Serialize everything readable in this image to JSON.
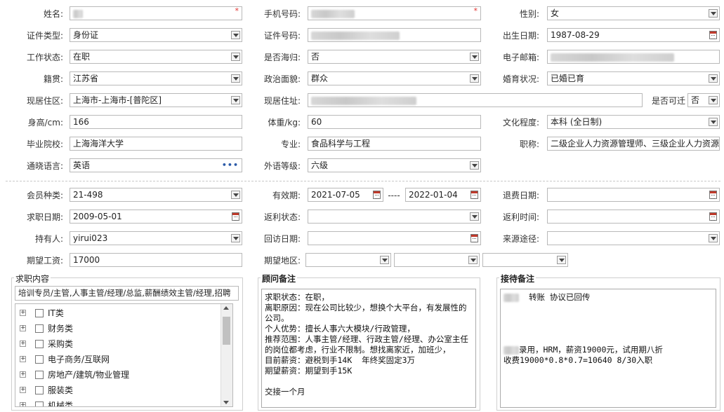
{
  "fields": {
    "name": {
      "label": "姓名:"
    },
    "phone": {
      "label": "手机号码:"
    },
    "gender": {
      "label": "性别:",
      "value": "女"
    },
    "id_type": {
      "label": "证件类型:",
      "value": "身份证"
    },
    "id_number": {
      "label": "证件号码:"
    },
    "birthdate": {
      "label": "出生日期:",
      "value": "1987-08-29"
    },
    "work_status": {
      "label": "工作状态:",
      "value": "在职"
    },
    "returnee": {
      "label": "是否海归:",
      "value": "否"
    },
    "email": {
      "label": "电子邮箱:"
    },
    "native_place": {
      "label": "籍贯:",
      "value": "江苏省"
    },
    "political_status": {
      "label": "政治面貌:",
      "value": "群众"
    },
    "marital_status": {
      "label": "婚育状况:",
      "value": "已婚已育"
    },
    "current_area": {
      "label": "现居住区:",
      "value": "上海市-上海市-[普陀区]"
    },
    "current_address": {
      "label": "现居住址:"
    },
    "relocate": {
      "label": "是否可迁",
      "value": "否"
    },
    "height": {
      "label": "身高/cm:",
      "value": "166"
    },
    "weight": {
      "label": "体重/kg:",
      "value": "60"
    },
    "education": {
      "label": "文化程度:",
      "value": "本科 (全日制)"
    },
    "school": {
      "label": "毕业院校:",
      "value": "上海海洋大学"
    },
    "major": {
      "label": "专业:",
      "value": "食品科学与工程"
    },
    "title": {
      "label": "职称:",
      "value": "二级企业人力资源管理师、三级企业人力资源"
    },
    "languages": {
      "label": "通晓语言:",
      "value": "英语"
    },
    "foreign_level": {
      "label": "外语等级:",
      "value": "六级"
    },
    "member_type": {
      "label": "会员种类:",
      "value": "21-498"
    },
    "valid_period": {
      "label": "有效期:",
      "start": "2021-07-05",
      "sep": "----",
      "end": "2022-01-04"
    },
    "refund_date": {
      "label": "退费日期:",
      "value": ""
    },
    "job_date": {
      "label": "求职日期:",
      "value": "2009-05-01"
    },
    "rebate_status": {
      "label": "返利状态:",
      "value": ""
    },
    "rebate_time": {
      "label": "返利时间:",
      "value": ""
    },
    "holder": {
      "label": "持有人:",
      "value": "yirui023"
    },
    "visit_date": {
      "label": "回访日期:",
      "value": ""
    },
    "source": {
      "label": "来源途径:",
      "value": ""
    },
    "expected_salary": {
      "label": "期望工资:",
      "value": "17000"
    },
    "expected_area": {
      "label": "期望地区:"
    }
  },
  "job_content": {
    "title": "求职内容",
    "selected": "培训专员/主管,人事主管/经理/总监,薪酬绩效主管/经理,招聘",
    "tree": [
      "IT类",
      "财务类",
      "采购类",
      "电子商务/互联网",
      "房地产/建筑/物业管理",
      "服装类",
      "机械类"
    ]
  },
  "advisor_notes": {
    "title": "顾问备注",
    "text": "求职状态：在职，\n离职原因：现在公司比较少，想换个大平台，有发展性的公司。\n个人优势：擅长人事六大模块/行政管理，\n推荐范围：人事主管/经理、行政主管/经理、办公室主任的岗位都考虑，行业不限制。想找离家近，加班少，\n目前薪资：避税到手14K  年终奖固定3万\n期望薪资：期望到手15K\n\n交接一个月"
  },
  "reception_notes": {
    "title": "接待备注",
    "line1": "转账  协议已回传",
    "line2": "录用，HRM，薪资19000元，试用期八折",
    "line3": "收费19000*0.8*0.7=10640  8/30入职"
  }
}
